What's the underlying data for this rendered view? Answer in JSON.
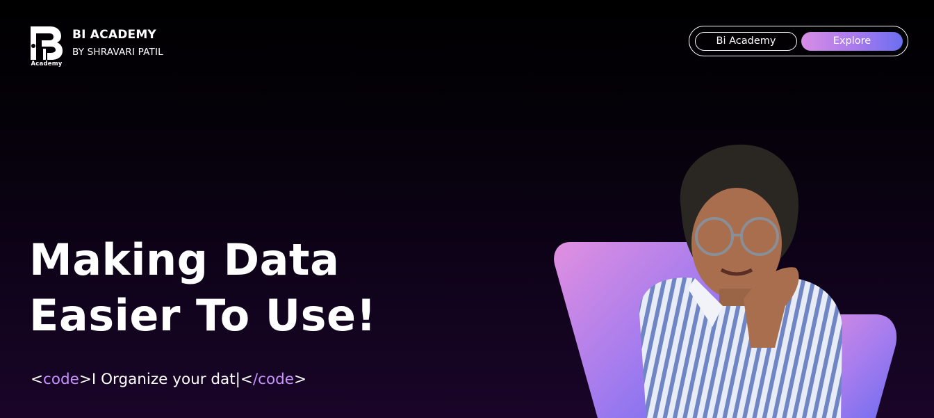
{
  "brand": {
    "logo_caption": "Academy",
    "title": "BI ACADEMY",
    "subtitle": "BY SHRAVARI PATIL"
  },
  "nav": {
    "home_label": "Bi Academy",
    "explore_label": "Explore"
  },
  "hero": {
    "title_line1": "Making Data",
    "title_line2": "Easier To Use!",
    "typing": {
      "open_lt": "<",
      "open_word": "code",
      "open_gt": ">",
      "text": "I Organize your dat|",
      "close_lt": "<",
      "close_word": "/code",
      "close_gt": ">"
    }
  },
  "colors": {
    "accent_pink": "#d78ee6",
    "accent_blue": "#6b6ff0",
    "code_tag": "#c792ff",
    "background": "#0a0210"
  },
  "icons": {
    "logo": "bi-academy-logo-icon",
    "portrait": "person-photo"
  }
}
